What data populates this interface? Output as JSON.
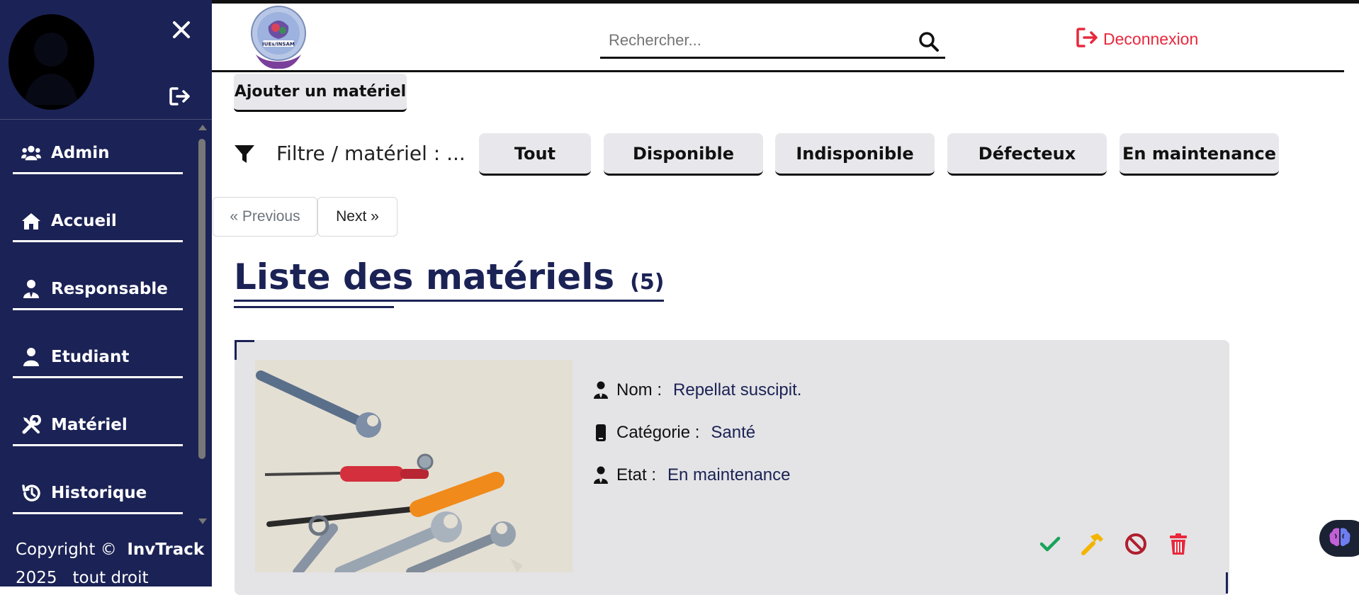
{
  "app": {
    "name": "InvTrack",
    "accent_color": "#1b2255",
    "danger_color": "#e8283c",
    "success_color": "#1aa35a",
    "warning_color": "#f4b400"
  },
  "sidebar": {
    "close_icon": "close-icon",
    "logout_icon": "logout-icon",
    "items": [
      {
        "label": "Admin",
        "icon": "users-icon"
      },
      {
        "label": "Accueil",
        "icon": "home-icon"
      },
      {
        "label": "Responsable",
        "icon": "user-tie-icon"
      },
      {
        "label": "Etudiant",
        "icon": "user-icon"
      },
      {
        "label": "Matériel",
        "icon": "tools-icon"
      },
      {
        "label": "Historique",
        "icon": "history-icon"
      }
    ],
    "copyright_prefix": "Copyright ©",
    "copyright_brand": "InvTrack",
    "copyright_year": "2025",
    "copyright_suffix": "tout droit reservé"
  },
  "header": {
    "logo_text": "IUEs/INSAM",
    "search_placeholder": "Rechercher...",
    "logout_label": "Deconnexion"
  },
  "toolbar": {
    "add_label": "Ajouter un matériel",
    "filter_label": "Filtre / matériel : ...",
    "filters": [
      "Tout",
      "Disponible",
      "Indisponible",
      "Défecteux",
      "En maintenance"
    ]
  },
  "pagination": {
    "prev_label": "« Previous",
    "next_label": "Next »"
  },
  "list": {
    "title": "Liste des matériels",
    "count": "(5)"
  },
  "items": [
    {
      "nom_key": "Nom :",
      "nom": "Repellat suscipit.",
      "categorie_key": "Catégorie :",
      "categorie": "Santé",
      "etat_key": "Etat :",
      "etat": "En maintenance",
      "actions": [
        "check-icon",
        "hammer-icon",
        "ban-icon",
        "trash-icon"
      ]
    }
  ]
}
